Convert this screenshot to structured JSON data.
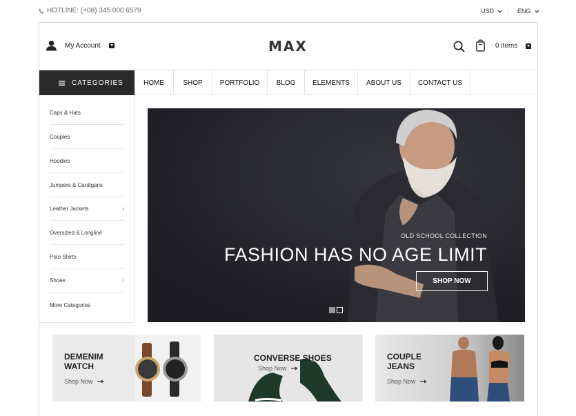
{
  "topbar": {
    "hotline": "HOTLINE: (+08) 345 000 6579",
    "currency": "USD",
    "language": "ENG"
  },
  "header": {
    "account_label": "My Account",
    "logo": "MAX",
    "cart_label": "0 items"
  },
  "nav": {
    "categories_label": "CATEGORIES",
    "menu": [
      "HOME",
      "SHOP",
      "PORTFOLIO",
      "BLOG",
      "ELEMENTS",
      "ABOUT US",
      "CONTACT US"
    ]
  },
  "sidebar": {
    "items": [
      {
        "label": "Caps & Hats",
        "has_submenu": false
      },
      {
        "label": "Couples",
        "has_submenu": false
      },
      {
        "label": "Hoodies",
        "has_submenu": false
      },
      {
        "label": "Jumpers & Cardigans",
        "has_submenu": false
      },
      {
        "label": "Leather Jackets",
        "has_submenu": true
      },
      {
        "label": "Oversized & Longline",
        "has_submenu": false
      },
      {
        "label": "Polo Shirts",
        "has_submenu": false
      },
      {
        "label": "Shoes",
        "has_submenu": true
      },
      {
        "label": "More Categories",
        "has_submenu": false
      }
    ]
  },
  "hero": {
    "kicker": "OLD SCHOOL COLLECTION",
    "headline": "FASHION HAS NO AGE LIMIT",
    "button": "SHOP NOW",
    "slide_count": 2,
    "active_slide": 1
  },
  "promos": [
    {
      "title_line1": "DEMENIM",
      "title_line2": "WATCH",
      "link": "Shop Now"
    },
    {
      "title_line1": "CONVERSE SHOES",
      "title_line2": "",
      "link": "Shop Now"
    },
    {
      "title_line1": "COUPLE",
      "title_line2": "JEANS",
      "link": "Shop Now"
    }
  ],
  "colors": {
    "dark": "#292929",
    "hero_bg": "#22222a",
    "border": "#e3e3e3"
  }
}
